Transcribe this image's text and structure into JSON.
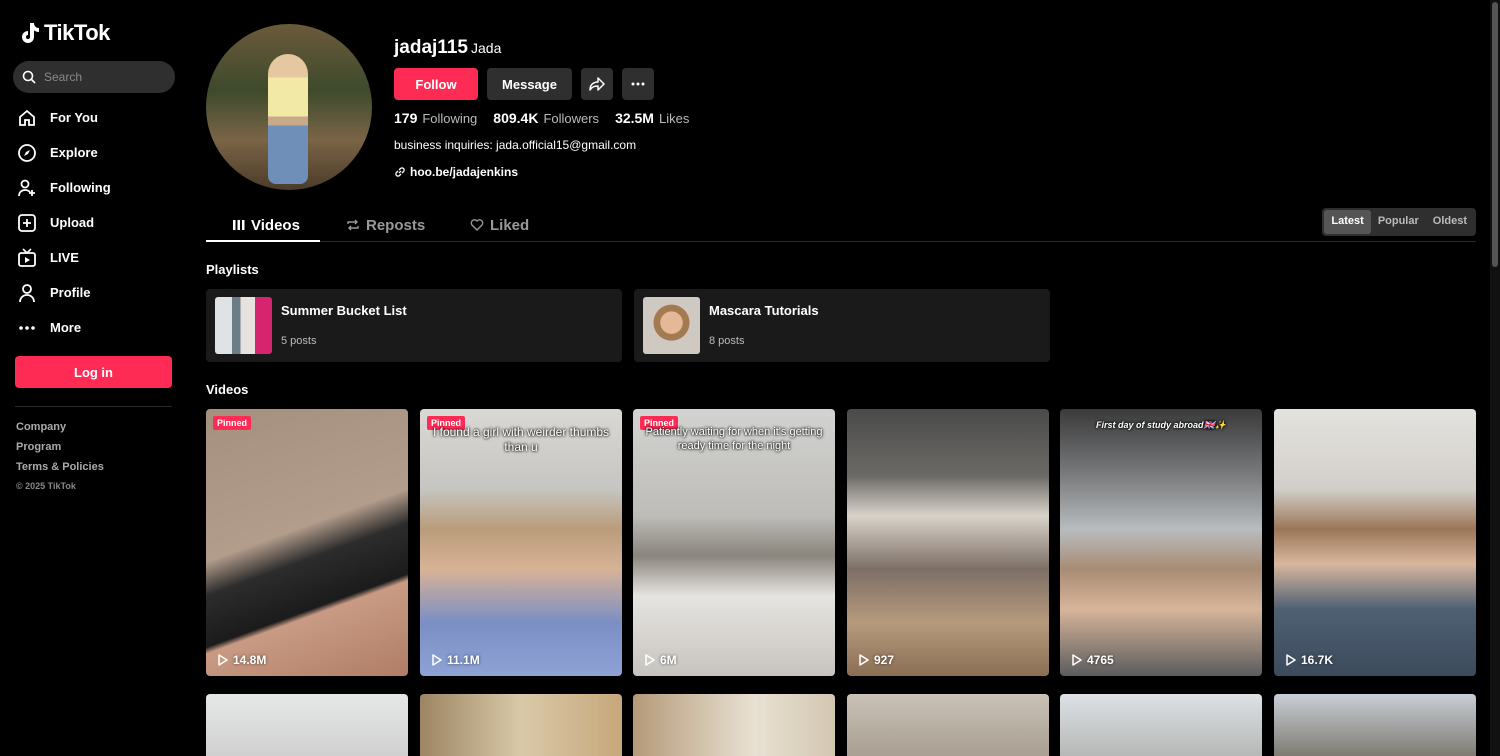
{
  "app": {
    "logo_text": "TikTok"
  },
  "search": {
    "placeholder": "Search"
  },
  "nav": [
    {
      "label": "For You",
      "icon": "home-icon"
    },
    {
      "label": "Explore",
      "icon": "compass-icon"
    },
    {
      "label": "Following",
      "icon": "user-follow-icon"
    },
    {
      "label": "Upload",
      "icon": "plus-square-icon"
    },
    {
      "label": "LIVE",
      "icon": "live-tv-icon"
    },
    {
      "label": "Profile",
      "icon": "person-icon"
    },
    {
      "label": "More",
      "icon": "more-dots-icon"
    }
  ],
  "login_label": "Log in",
  "footer": {
    "company": "Company",
    "program": "Program",
    "terms": "Terms & Policies",
    "copyright": "© 2025 TikTok"
  },
  "profile": {
    "username": "jadaj115",
    "nickname": "Jada",
    "follow_label": "Follow",
    "message_label": "Message",
    "following_count": "179",
    "following_label": "Following",
    "followers_count": "809.4K",
    "followers_label": "Followers",
    "likes_count": "32.5M",
    "likes_label": "Likes",
    "bio": "business inquiries: jada.official15@gmail.com",
    "link": "hoo.be/jadajenkins"
  },
  "tabs": [
    {
      "label": "Videos"
    },
    {
      "label": "Reposts"
    },
    {
      "label": "Liked"
    }
  ],
  "sort": [
    "Latest",
    "Popular",
    "Oldest"
  ],
  "playlists_title": "Playlists",
  "playlists": [
    {
      "name": "Summer Bucket List",
      "count": "5 posts"
    },
    {
      "name": "Mascara Tutorials",
      "count": "8 posts"
    }
  ],
  "videos_title": "Videos",
  "videos": [
    {
      "views": "14.8M",
      "pinned": "Pinned",
      "caption": ""
    },
    {
      "views": "11.1M",
      "pinned": "Pinned",
      "caption": "I found a girl with weirder thumbs than u"
    },
    {
      "views": "6M",
      "pinned": "Pinned",
      "caption": "Patiently waiting for when it's getting ready time for the night"
    },
    {
      "views": "927",
      "pinned": "",
      "caption": ""
    },
    {
      "views": "4765",
      "pinned": "",
      "caption": "First day of study abroad🇬🇧✨"
    },
    {
      "views": "16.7K",
      "pinned": "",
      "caption": ""
    }
  ]
}
